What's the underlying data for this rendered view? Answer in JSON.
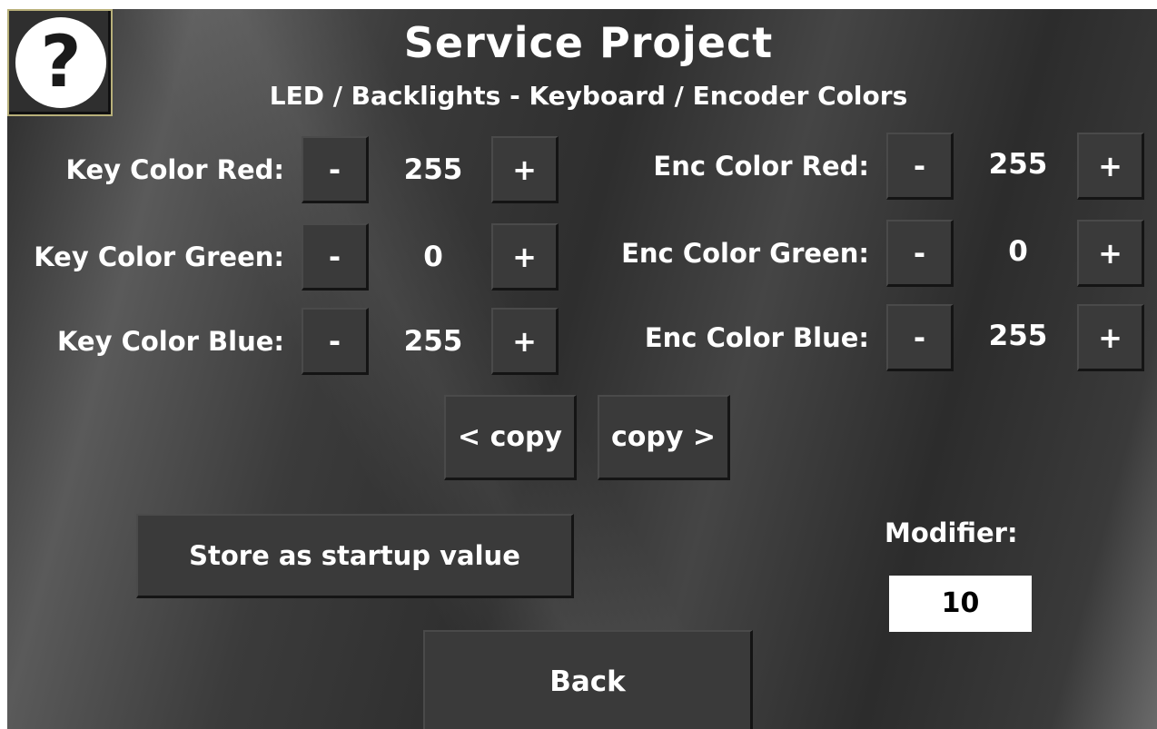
{
  "header": {
    "help_symbol": "?",
    "title": "Service Project",
    "subtitle": "LED / Backlights - Keyboard / Encoder Colors"
  },
  "key_colors": {
    "red": {
      "label": "Key Color Red:",
      "value": "255"
    },
    "green": {
      "label": "Key Color Green:",
      "value": "0"
    },
    "blue": {
      "label": "Key Color Blue:",
      "value": "255"
    }
  },
  "enc_colors": {
    "red": {
      "label": "Enc Color Red:",
      "value": "255"
    },
    "green": {
      "label": "Enc Color Green:",
      "value": "0"
    },
    "blue": {
      "label": "Enc Color Blue:",
      "value": "255"
    }
  },
  "buttons": {
    "minus": "-",
    "plus": "+",
    "copy_left": "< copy",
    "copy_right": "copy >",
    "store": "Store as startup value",
    "back": "Back"
  },
  "modifier": {
    "label": "Modifier:",
    "value": "10"
  },
  "icons": {
    "help": "help-icon"
  },
  "colors": {
    "text": "#ffffff",
    "modifier_field_bg": "#ffffff",
    "help_border": "#b8b07a"
  }
}
